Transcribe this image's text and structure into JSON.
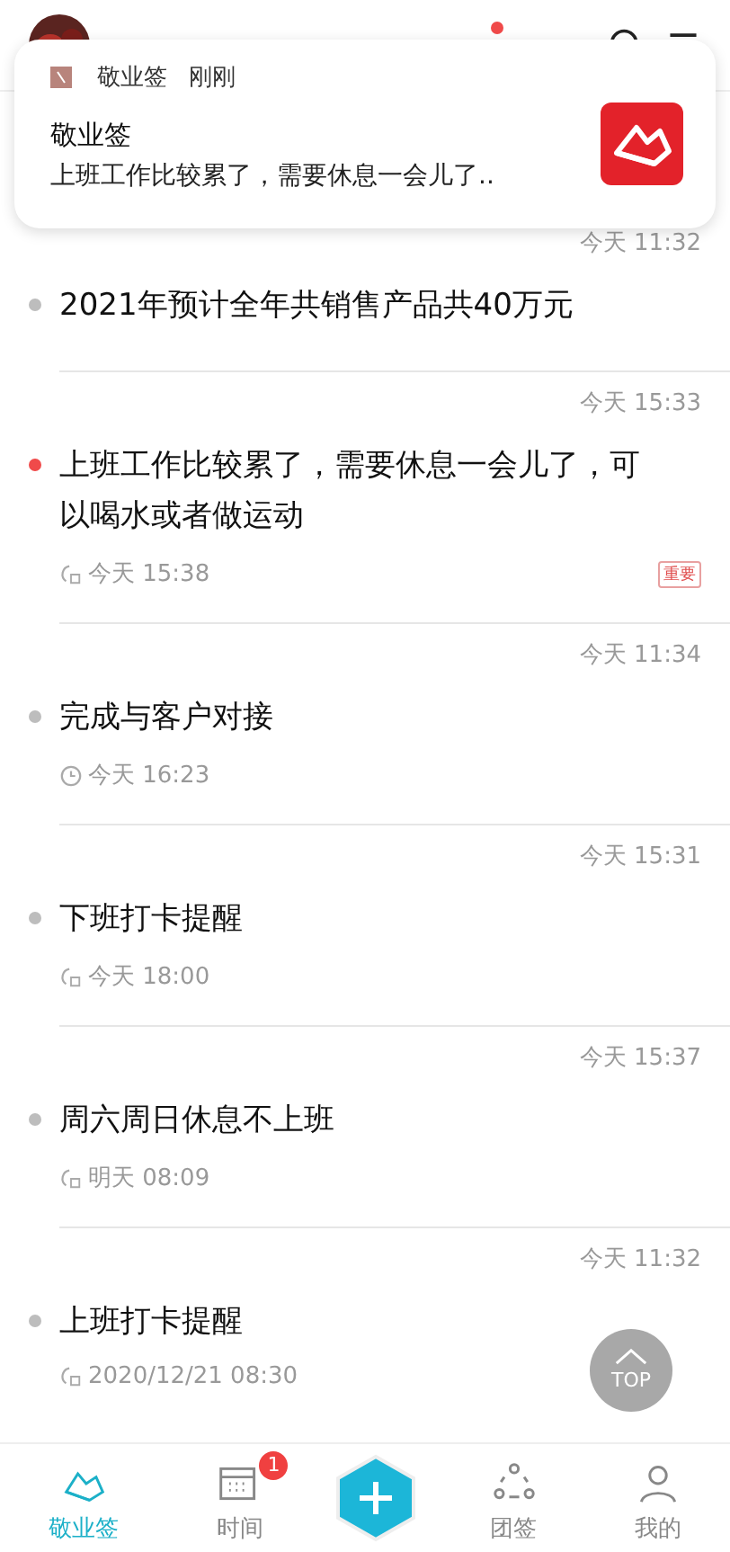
{
  "header": {
    "unread": true
  },
  "notification": {
    "app": "敬业签",
    "time": "刚刚",
    "title": "敬业签",
    "body": "上班工作比较累了，需要休息一会儿了.."
  },
  "notes": [
    {
      "time": "今天 11:32",
      "title": "2021年预计全年共销售产品共40万元",
      "color": "#bdbdbd"
    },
    {
      "time": "今天 15:33",
      "title": "上班工作比较累了，需要休息一会儿了，可以喝水或者做运动",
      "color": "#f04a4a",
      "reminder": {
        "kind": "repeat",
        "time": "今天 15:38"
      },
      "tag": "重要"
    },
    {
      "time": "今天 11:34",
      "title": "完成与客户对接",
      "color": "#bdbdbd",
      "reminder": {
        "kind": "clock",
        "time": "今天 16:23"
      }
    },
    {
      "time": "今天 15:31",
      "title": "下班打卡提醒",
      "color": "#bdbdbd",
      "reminder": {
        "kind": "repeat",
        "time": "今天 18:00"
      }
    },
    {
      "time": "今天 15:37",
      "title": "周六周日休息不上班",
      "color": "#bdbdbd",
      "reminder": {
        "kind": "repeat",
        "time": "明天 08:09"
      }
    },
    {
      "time": "今天 11:32",
      "title": "上班打卡提醒",
      "color": "#bdbdbd",
      "reminder": {
        "kind": "repeat",
        "time": "2020/12/21 08:30"
      }
    }
  ],
  "top_button": "TOP",
  "tabs": [
    {
      "kind": "note",
      "label": "敬业签",
      "selected": true
    },
    {
      "kind": "calendar",
      "label": "时间",
      "selected": false,
      "badge": "1"
    },
    {
      "kind": "add"
    },
    {
      "kind": "team",
      "label": "团签",
      "selected": false
    },
    {
      "kind": "user",
      "label": "我的",
      "selected": false
    }
  ]
}
